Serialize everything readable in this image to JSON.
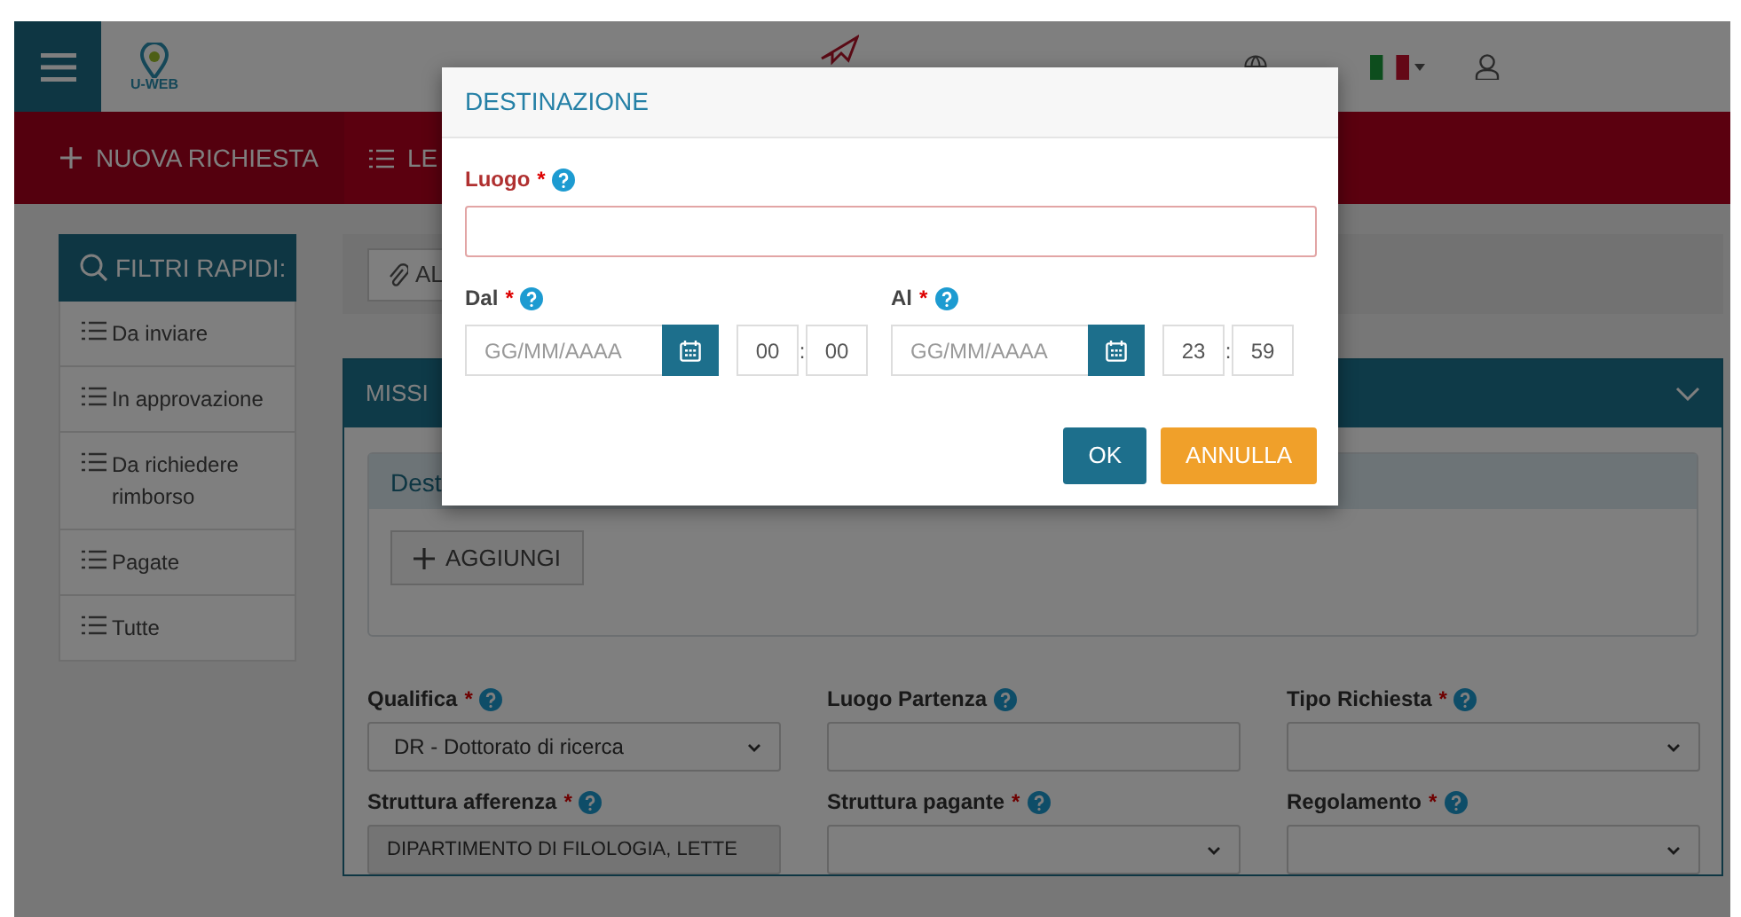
{
  "header": {
    "logo_text": "U-WEB"
  },
  "nav": [
    {
      "label": "NUOVA RICHIESTA"
    },
    {
      "label": "LE"
    }
  ],
  "sidebar": {
    "title": "FILTRI RAPIDI:",
    "items": [
      "Da inviare",
      "In approvazione",
      "Da richiedere rimborso",
      "Pagate",
      "Tutte"
    ]
  },
  "toolbar": {
    "button": "AL"
  },
  "card": {
    "title": "MISSI",
    "panel_title": "Dest",
    "add_button": "AGGIUNGI"
  },
  "fields": [
    {
      "label": "Qualifica",
      "required_mark": "*",
      "kind": "select",
      "value": "DR - Dottorato di ricerca"
    },
    {
      "label": "Luogo Partenza",
      "kind": "input"
    },
    {
      "label": "Tipo Richiesta",
      "required_mark": "*",
      "kind": "select"
    },
    {
      "label": "Struttura afferenza",
      "required_mark": "*",
      "kind": "readonly",
      "value": "DIPARTIMENTO DI FILOLOGIA, LETTE"
    },
    {
      "label": "Struttura pagante",
      "required_mark": "*",
      "kind": "select"
    },
    {
      "label": "Regolamento",
      "required_mark": "*",
      "kind": "select"
    }
  ],
  "modal": {
    "title": "DESTINAZIONE",
    "place": {
      "label": "Luogo",
      "required_mark": "*",
      "invalid": true
    },
    "ranges": [
      {
        "label": "Dal",
        "required_mark": "*",
        "placeholder": "GG/MM/AAAA",
        "hour": "00",
        "separator": ":",
        "minute": "00"
      },
      {
        "label": "Al",
        "required_mark": "*",
        "placeholder": "GG/MM/AAAA",
        "hour": "23",
        "separator": ":",
        "minute": "59"
      }
    ],
    "buttons": [
      {
        "label": "OK",
        "kind": "primary"
      },
      {
        "label": "ANNULLA",
        "kind": "cancel"
      }
    ]
  }
}
